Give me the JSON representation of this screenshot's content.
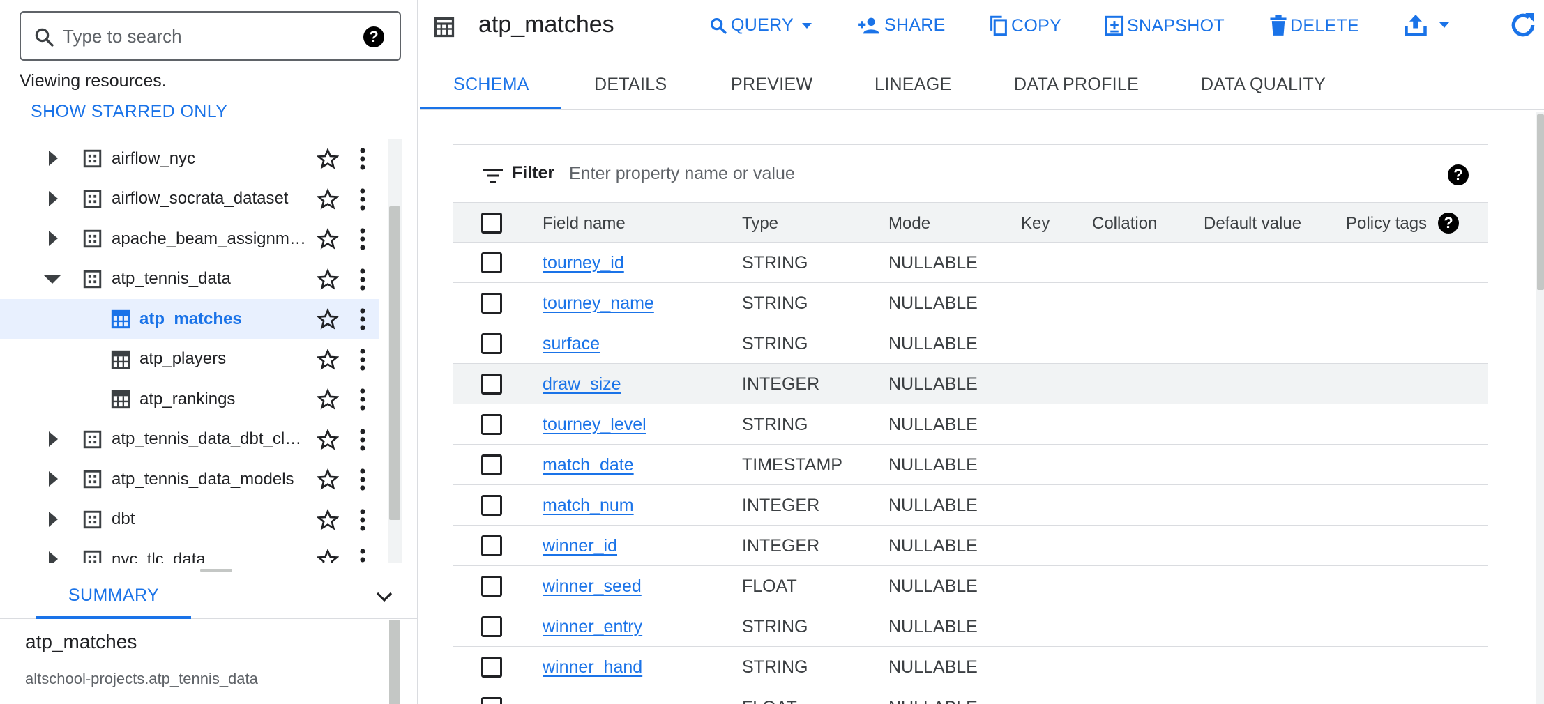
{
  "search": {
    "placeholder": "Type to search"
  },
  "viewing_text": "Viewing resources.",
  "show_starred_label": "SHOW STARRED ONLY",
  "tree": {
    "items": [
      {
        "label": "airflow_nyc",
        "kind": "dataset",
        "state": "collapsed"
      },
      {
        "label": "airflow_socrata_dataset",
        "kind": "dataset",
        "state": "collapsed"
      },
      {
        "label": "apache_beam_assignme…",
        "kind": "dataset",
        "state": "collapsed"
      },
      {
        "label": "atp_tennis_data",
        "kind": "dataset",
        "state": "expanded"
      },
      {
        "label": "atp_matches",
        "kind": "table",
        "selected": true
      },
      {
        "label": "atp_players",
        "kind": "table"
      },
      {
        "label": "atp_rankings",
        "kind": "table"
      },
      {
        "label": "atp_tennis_data_dbt_clo…",
        "kind": "dataset",
        "state": "collapsed"
      },
      {
        "label": "atp_tennis_data_models",
        "kind": "dataset",
        "state": "collapsed"
      },
      {
        "label": "dbt",
        "kind": "dataset",
        "state": "collapsed"
      },
      {
        "label": "nyc_tlc_data",
        "kind": "dataset",
        "state": "collapsed"
      }
    ]
  },
  "summary": {
    "tab_label": "SUMMARY",
    "title": "atp_matches",
    "subtitle": "altschool-projects.atp_tennis_data"
  },
  "toolbar": {
    "title": "atp_matches",
    "query_label": "QUERY",
    "share_label": "SHARE",
    "copy_label": "COPY",
    "snapshot_label": "SNAPSHOT",
    "delete_label": "DELETE"
  },
  "tabs": [
    "SCHEMA",
    "DETAILS",
    "PREVIEW",
    "LINEAGE",
    "DATA PROFILE",
    "DATA QUALITY"
  ],
  "filter": {
    "label": "Filter",
    "placeholder": "Enter property name or value"
  },
  "schema": {
    "headers": {
      "field_name": "Field name",
      "type": "Type",
      "mode": "Mode",
      "key": "Key",
      "collation": "Collation",
      "default_value": "Default value",
      "policy_tags": "Policy tags"
    },
    "rows": [
      {
        "name": "tourney_id",
        "type": "STRING",
        "mode": "NULLABLE"
      },
      {
        "name": "tourney_name",
        "type": "STRING",
        "mode": "NULLABLE"
      },
      {
        "name": "surface",
        "type": "STRING",
        "mode": "NULLABLE"
      },
      {
        "name": "draw_size",
        "type": "INTEGER",
        "mode": "NULLABLE"
      },
      {
        "name": "tourney_level",
        "type": "STRING",
        "mode": "NULLABLE"
      },
      {
        "name": "match_date",
        "type": "TIMESTAMP",
        "mode": "NULLABLE"
      },
      {
        "name": "match_num",
        "type": "INTEGER",
        "mode": "NULLABLE"
      },
      {
        "name": "winner_id",
        "type": "INTEGER",
        "mode": "NULLABLE"
      },
      {
        "name": "winner_seed",
        "type": "FLOAT",
        "mode": "NULLABLE"
      },
      {
        "name": "winner_entry",
        "type": "STRING",
        "mode": "NULLABLE"
      },
      {
        "name": "winner_hand",
        "type": "STRING",
        "mode": "NULLABLE"
      },
      {
        "name": "",
        "type": "FLOAT",
        "mode": "NULLABLE"
      }
    ]
  },
  "colors": {
    "accent": "#1a73e8",
    "selected_bg": "#e8f0fe",
    "header_bg": "#f1f3f4",
    "text": "#202124",
    "muted": "#5f6368",
    "border": "#dadce0"
  },
  "icons": {
    "search": "search-icon",
    "help": "help-icon",
    "dataset": "dataset-icon",
    "table": "table-icon",
    "star": "star-outline-icon",
    "kebab": "more-vert-icon",
    "chevron": "chevron-down-icon",
    "filter": "filter-icon",
    "refresh": "refresh-icon",
    "export": "export-icon"
  }
}
